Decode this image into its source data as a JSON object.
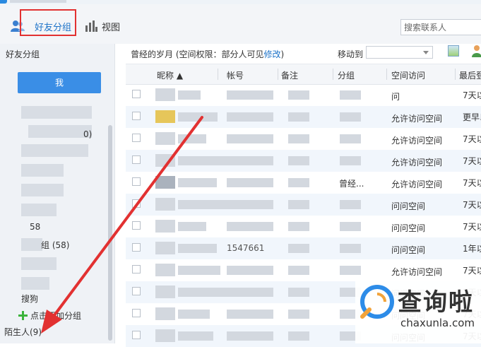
{
  "toolbar": {
    "friends_group_label": "好友分组",
    "view_label": "视图",
    "search_placeholder": "搜索联系人"
  },
  "sidebar": {
    "title": "好友分组",
    "active_group_label": "我",
    "group_partial_1": "58",
    "group_partial_2": "组 (58)",
    "group_partial_3": "搜狗",
    "add_group_label": "点击添加分组",
    "strangers_label": "陌生人(9)"
  },
  "path_bar": {
    "group_name": "曾经的岁月",
    "permission_text": "(空间权限：部分人可见",
    "edit_link": "修改",
    "permission_close": ")",
    "move_to_label": "移动到"
  },
  "table": {
    "columns": [
      "昵称",
      "帐号",
      "备注",
      "分组",
      "空间访问",
      "最后登"
    ],
    "rows": [
      {
        "access": "问",
        "last": "7天以"
      },
      {
        "access": "允许访问空间",
        "last": "更早以"
      },
      {
        "access": "允许访问空间",
        "last": "7天以"
      },
      {
        "access": "允许访问空间",
        "last": "7天以"
      },
      {
        "group": "曾经...",
        "access": "允许访问空间",
        "last": "7天以"
      },
      {
        "access": "问问空间",
        "last": "7天以"
      },
      {
        "access": "问问空间",
        "last": "7天以"
      },
      {
        "account": "1547661",
        "access": "问问空间",
        "last": "1年以"
      },
      {
        "access": "允许访问空间",
        "last": "7天以"
      },
      {
        "access": "问问空间",
        "last": "7天以"
      },
      {
        "access": "问问空间",
        "last": "7天以"
      },
      {
        "access": "问问空间",
        "last": "7天以"
      }
    ]
  },
  "watermark": {
    "brand": "查询啦",
    "domain": "chaxunla.com"
  },
  "colors": {
    "accent": "#1e73c8",
    "highlight_box": "#e23131",
    "arrow": "#e23131",
    "active_button": "#3a8ee6"
  }
}
